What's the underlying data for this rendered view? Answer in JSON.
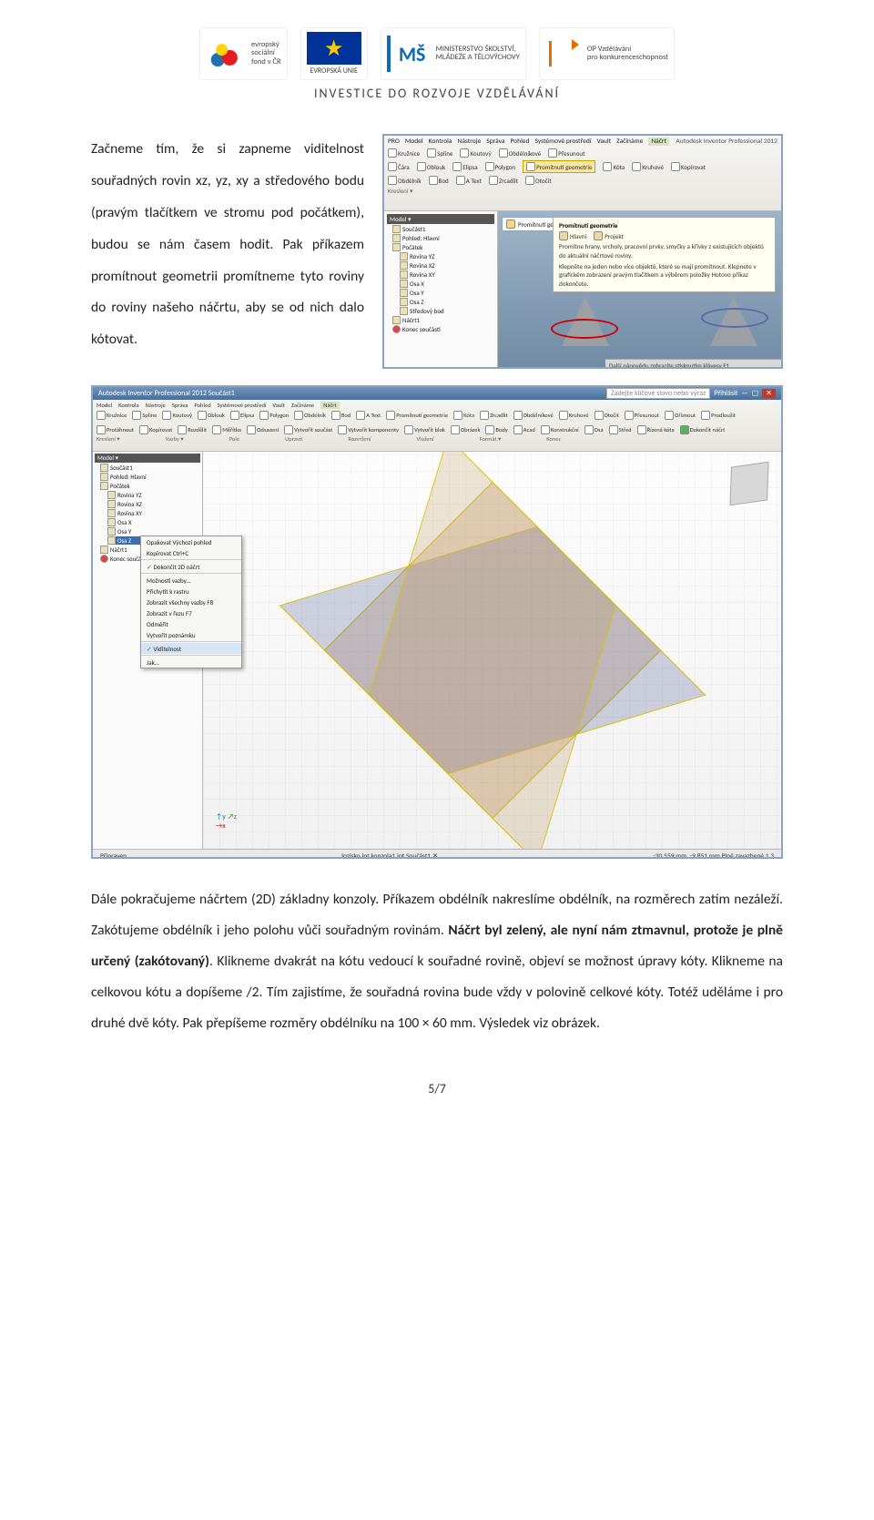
{
  "header": {
    "esf_text_line1": "evropský",
    "esf_text_line2": "sociální",
    "esf_text_line3": "fond v ČR",
    "eu_label": "EVROPSKÁ UNIE",
    "msmt_line1": "MINISTERSTVO ŠKOLSTVÍ,",
    "msmt_line2": "MLÁDEŽE A TĚLOVÝCHOVY",
    "opvk_line1": "OP Vzdělávání",
    "opvk_line2": "pro konkurenceschopnost",
    "slogan": "INVESTICE DO ROZVOJE VZDĚLÁVÁNÍ"
  },
  "paragraph_left": "Začneme tím, že si zapneme viditelnost souřadných rovin xz, yz, xy a středového bodu (pravým tlačítkem ve stromu pod počátkem), budou se nám časem hodit. Pak příkazem promítnout geometrii promítneme tyto roviny do roviny našeho náčrtu, aby se od nich dalo kótovat.",
  "shot1": {
    "title_right": "Autodesk Inventor Professional 2012",
    "menu": [
      "PRO",
      "Model",
      "Kontrola",
      "Nástroje",
      "Správa",
      "Pohled",
      "Systémové prostředí",
      "Vault",
      "Začínáme",
      "Náčrt"
    ],
    "tools_row1": [
      {
        "label": "Kružnice"
      },
      {
        "label": "Spline"
      },
      {
        "label": "Koutový"
      },
      {
        "label": "Oblouk"
      },
      {
        "label": "Elipsa"
      },
      {
        "label": "Polygon"
      },
      {
        "label": "Obdélník"
      },
      {
        "label": "Bod"
      },
      {
        "label": "A Text"
      }
    ],
    "tools_row2": [
      {
        "label": "Čára"
      },
      {
        "label": "Promítnutí geometrie"
      },
      {
        "label": "Kóta"
      },
      {
        "label": "Obdélníkové"
      },
      {
        "label": "Kruhové"
      },
      {
        "label": "Zrcadlit"
      },
      {
        "label": "Přesunout"
      },
      {
        "label": "Kopírovat"
      },
      {
        "label": "Otočit"
      }
    ],
    "group_label": "Kreslení ▾",
    "model_panel_title": "Model ▾",
    "tree": [
      "Součást1",
      "Pohled: Hlavní",
      "Počátek",
      "Rovina YZ",
      "Rovina XZ",
      "Rovina XY",
      "Osa X",
      "Osa Y",
      "Osa Z",
      "Středový bod",
      "Náčrt1",
      "Konec součásti"
    ],
    "highlight_button": "Promítnutí geometrie",
    "tooltip_title": "Promítnutí geometrie",
    "tooltip_item1": "Hlavní",
    "tooltip_item2": "Projekt",
    "tooltip_body1": "Promítne hrany, vrcholy, pracovní prvky, smyčky a křivky z existujících objektů do aktuální náčrtové roviny.",
    "tooltip_body2": "Klepněte na jeden nebo více objektů, které se mají promítnout. Klepnete v grafickém zobrazení pravým tlačítkem a výběrem položky Hotovo příkaz dokončete.",
    "tooltip_footer": "Další nápovědu zobrazíte stisknutím klávesy F1."
  },
  "shot2": {
    "titlebar_left": "Autodesk Inventor Professional 2012   Součást1",
    "titlebar_search_placeholder": "Zadejte klíčové slovo nebo výraz",
    "titlebar_right": "Přihlásit",
    "tabs": [
      "Model",
      "Kontrola",
      "Nástroje",
      "Správa",
      "Pohled",
      "Systémové prostředí",
      "Vault",
      "Začínáme",
      "Náčrt"
    ],
    "tool_labels": [
      "Kružnice",
      "Spline",
      "Koutový",
      "Oblouk",
      "Elipsa",
      "Polygon",
      "Obdélník",
      "Bod",
      "A Text",
      "Promítnutí geometrie",
      "Kóta",
      "Zrcadlit",
      "Obdélníkové",
      "Kruhové",
      "Otočit",
      "Přesunout",
      "Oříznout",
      "Prodloužit",
      "Protáhnout",
      "Kopírovat",
      "Rozdělit",
      "Měřítko",
      "Odsazení",
      "Vytvořit součást",
      "Vytvořit komponenty",
      "Vytvořit blok",
      "Obrázek",
      "Body",
      "Acad",
      "Konstrukční",
      "Osa",
      "Střed",
      "Řízená kóta",
      "Dokončit náčrt"
    ],
    "panel_labels": [
      "Kreslení ▾",
      "Vazby ▾",
      "Pole",
      "Upravit",
      "Rozvržení",
      "Vložení",
      "Formát ▾",
      "Konec"
    ],
    "tree": [
      "Součást1",
      "Pohled: Hlavní",
      "Počátek",
      "Rovina YZ",
      "Rovina XZ",
      "Rovina XY",
      "Osa X",
      "Osa Y",
      "Osa Z",
      "Náčrt1",
      "Konec součásti"
    ],
    "context_menu": [
      {
        "label": "Opakovat Výchozí pohled",
        "chk": false
      },
      {
        "label": "Kopírovat          Ctrl+C",
        "chk": false
      },
      {
        "label": "Dokončit 2D náčrt",
        "chk": true
      },
      {
        "label": "Možnosti vazby…",
        "chk": false
      },
      {
        "label": "Přichytit k rastru",
        "chk": false
      },
      {
        "label": "Zobrazit všechny vazby   F8",
        "chk": false
      },
      {
        "label": "Zobrazit v řezu          F7",
        "chk": false
      },
      {
        "label": "Odměřit",
        "chk": false
      },
      {
        "label": "Vytvořit poznámku",
        "chk": false
      },
      {
        "label": "Viditelnost",
        "chk": true
      },
      {
        "label": "Jak…",
        "chk": false
      }
    ],
    "status_left": "Připraven",
    "status_tabs": "lozisko.ipt   konzola1.ipt   Součást1  ✕",
    "status_right": "-30,559 mm, -9,851 mm   Plně zavazbené   1        3"
  },
  "paragraph_bottom_part1": "Dále pokračujeme náčrtem (2D) základny konzoly. Příkazem obdélník nakreslíme obdélník, na rozměrech zatím nezáleží. Zakótujeme obdélník i jeho polohu vůči souřadným rovinám. ",
  "paragraph_bottom_bold": "Náčrt byl zelený, ale nyní nám ztmavnul, protože je plně určený (zakótovaný)",
  "paragraph_bottom_part2": ". Klikneme dvakrát na kótu vedoucí k souřadné rovině, objeví se možnost úpravy kóty. Klikneme na celkovou kótu a dopíšeme /2. Tím zajistíme, že souřadná rovina bude vždy v polovině celkové kóty. Totéž uděláme i pro druhé dvě kóty. Pak přepíšeme rozměry obdélníku na 100 × 60 mm. Výsledek viz obrázek.",
  "page_number": "5/7"
}
